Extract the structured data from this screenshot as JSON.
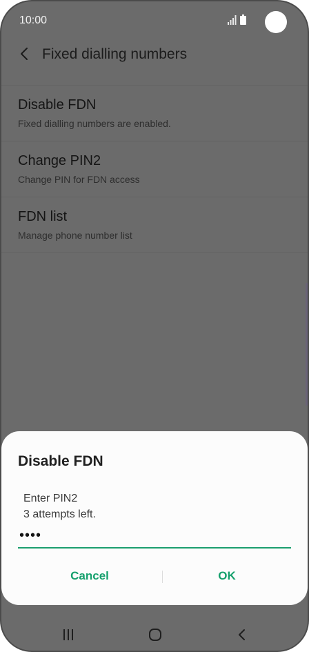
{
  "status_bar": {
    "time": "10:00"
  },
  "header": {
    "title": "Fixed dialling numbers",
    "back_icon": "chevron-left-icon"
  },
  "settings": {
    "items": [
      {
        "title": "Disable FDN",
        "subtitle": "Fixed dialling numbers are enabled."
      },
      {
        "title": "Change PIN2",
        "subtitle": "Change PIN for FDN access"
      },
      {
        "title": "FDN list",
        "subtitle": "Manage phone number list"
      }
    ]
  },
  "dialog": {
    "title": "Disable FDN",
    "label": "Enter PIN2",
    "attempts": "3 attempts left.",
    "pin_value": "••••",
    "cancel_label": "Cancel",
    "ok_label": "OK",
    "accent_color": "#16a06d"
  },
  "nav_bar": {
    "icons": [
      "recents-icon",
      "home-icon",
      "back-icon"
    ]
  }
}
